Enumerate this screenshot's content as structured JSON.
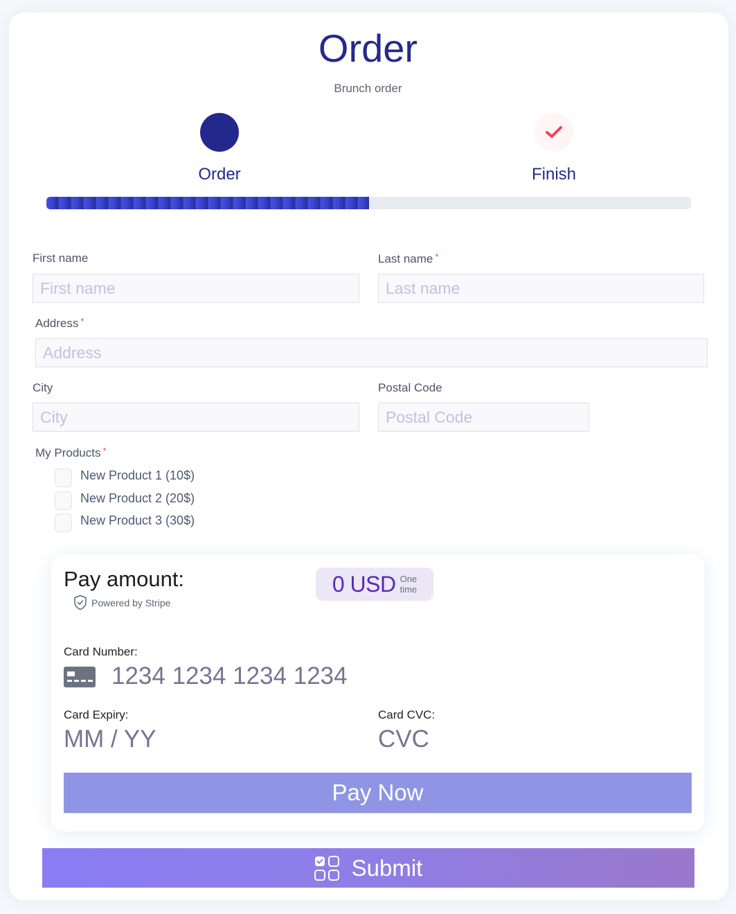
{
  "header": {
    "title": "Order",
    "subtitle": "Brunch order"
  },
  "steps": [
    {
      "label": "Order",
      "state": "current"
    },
    {
      "label": "Finish",
      "state": "pending",
      "icon": "check-icon"
    }
  ],
  "progress": {
    "percent": 50,
    "fill_color": "#3b46d6",
    "track_color": "#e8ebef"
  },
  "form": {
    "first_name": {
      "label": "First name",
      "placeholder": "First name",
      "value": "",
      "required": false
    },
    "last_name": {
      "label": "Last name",
      "placeholder": "Last name",
      "value": "",
      "required": true
    },
    "address": {
      "label": "Address",
      "placeholder": "Address",
      "value": "",
      "required": true
    },
    "city": {
      "label": "City",
      "placeholder": "City",
      "value": "",
      "required": false
    },
    "postal_code": {
      "label": "Postal Code",
      "placeholder": "Postal Code",
      "value": "",
      "required": false
    },
    "required_marker": "*",
    "products": {
      "label": "My Products",
      "required": true,
      "options": [
        {
          "label": "New Product 1 (10$)",
          "checked": false
        },
        {
          "label": "New Product 2 (20$)",
          "checked": false
        },
        {
          "label": "New Product 3 (30$)",
          "checked": false
        }
      ]
    }
  },
  "payment": {
    "title": "Pay amount:",
    "powered_by": "Powered by Stripe",
    "amount": "0 USD",
    "frequency_line1": "One",
    "frequency_line2": "time",
    "card_number_label": "Card Number:",
    "card_number_placeholder": "1234 1234 1234 1234",
    "expiry_label": "Card Expiry:",
    "expiry_placeholder": "MM / YY",
    "cvc_label": "Card CVC:",
    "cvc_placeholder": "CVC",
    "pay_button": "Pay Now"
  },
  "submit_button": "Submit",
  "colors": {
    "primary": "#23298c",
    "accent_check": "#f0435a",
    "pay_button": "#8f95e4",
    "submit_gradient_start": "#8a7df4",
    "submit_gradient_end": "#9a78cc",
    "amount_text": "#5a2ab6"
  }
}
